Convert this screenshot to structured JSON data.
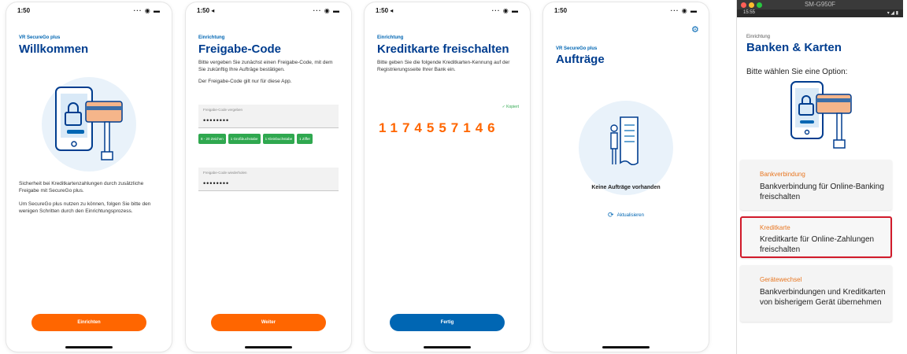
{
  "screens": [
    {
      "status_time": "1:50",
      "eyebrow": "VR SecureGo plus",
      "title": "Willkommen",
      "paragraph1": "Sicherheit bei Kreditkartenzahlungen durch zusätzliche Freigabe mit SecureGo plus.",
      "paragraph2": "Um SecureGo plus nutzen zu können, folgen Sie bitte den wenigen Schritten durch den Einrichtungsprozess.",
      "button": "Einrichten"
    },
    {
      "status_time": "1:50 ◂",
      "eyebrow": "Einrichtung",
      "title": "Freigabe-Code",
      "paragraph1": "Bitte vergeben Sie zunächst einen Freigabe-Code, mit dem Sie zukünftig Ihre Aufträge bestätigen.",
      "paragraph2": "Der Freigabe-Code gilt nur für diese App.",
      "field1_label": "Freigabe-Code vergeben",
      "field1_value": "••••••••",
      "chips": [
        "8 - 20 Zeichen",
        "1 Großbuchstabe",
        "1 Kleinbuchstabe",
        "1 Ziffer"
      ],
      "field2_label": "Freigabe-Code wiederholen",
      "field2_value": "••••••••",
      "button": "Weiter"
    },
    {
      "status_time": "1:50 ◂",
      "eyebrow": "Einrichtung",
      "title": "Kreditkarte freischalten",
      "paragraph1": "Bitte geben Sie die folgende Kreditkarten-Kennung auf der Registrierungsseite Ihrer Bank ein.",
      "copied": "✓ Kopiert",
      "code": "1174557146",
      "button": "Fertig"
    },
    {
      "status_time": "1:50",
      "eyebrow": "VR SecureGo plus",
      "title": "Aufträge",
      "empty": "Keine Aufträge vorhanden",
      "refresh": "Aktualisieren"
    }
  ],
  "android": {
    "window_title": "SM-G950F",
    "status_time": "15:55",
    "eyebrow": "Einrichtung",
    "title": "Banken & Karten",
    "subtitle": "Bitte wählen Sie eine Option:",
    "options": [
      {
        "tag": "Bankverbindung",
        "desc": "Bankverbindung für Online-Banking freischalten"
      },
      {
        "tag": "Kreditkarte",
        "desc": "Kreditkarte für Online-Zahlungen freischalten"
      },
      {
        "tag": "Gerätewechsel",
        "desc": "Bankverbindungen und Kreditkarten von bisherigem Gerät übernehmen"
      }
    ],
    "selected_option": 1
  },
  "colors": {
    "brand_blue": "#003d8f",
    "accent_orange": "#ff6600",
    "button_blue": "#0066b3",
    "chip_green": "#2fa84f",
    "highlight_red": "#d11a2a"
  }
}
